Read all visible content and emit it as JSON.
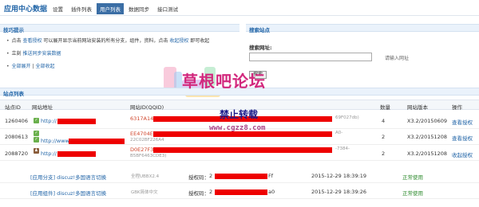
{
  "app": {
    "title": "应用中心数据"
  },
  "nav": {
    "tabs": [
      {
        "label": "设置"
      },
      {
        "label": "插件列表"
      },
      {
        "label": "用户列表"
      },
      {
        "label": "数据同步"
      },
      {
        "label": "接口测试"
      }
    ]
  },
  "tips": {
    "heading": "技巧提示",
    "line1_pre": "点击",
    "line1_link1": "查看授权",
    "line1_mid": "可以展开显示当前网站安装的所有分支，组件，资料，点击",
    "line1_link2": "收起授权",
    "line1_post": "即可收起",
    "line2_pre": "立刻",
    "line2_link": "推送同步安装数据",
    "line3_link1": "全部展开",
    "line3_sep": "|",
    "line3_link2": "全部收起"
  },
  "search": {
    "heading": "搜索站点",
    "label": "搜索网址:",
    "value": "",
    "placeholder": "",
    "hint": "请输入网址",
    "button": "搜索"
  },
  "sites": {
    "heading": "站点列表",
    "columns": [
      "站点ID",
      "网站地址",
      "网站ID(QQID)",
      "数量",
      "网站版本",
      "操作"
    ],
    "rows": [
      {
        "id": "1260406",
        "url": "http://",
        "qqid": "6317A14",
        "qqid_tail": "69F027db)",
        "sub": "",
        "count": "4",
        "version": "X3.2/20150609",
        "op": "查看授权"
      },
      {
        "id": "2080613",
        "url": "http://www.",
        "qqid": "EE4704E",
        "qqid_tail": "A0-",
        "sub": "22C02BF226A4",
        "count": "2",
        "version": "X3.2/20151208",
        "op": "查看授权"
      },
      {
        "id": "2088720",
        "url": "http://",
        "qqid": "D0E27F3",
        "qqid_tail": "-7384-",
        "sub": "B5BF6463CDE3)",
        "count": "2",
        "version": "X3.2/20151208",
        "op": "收起授权"
      }
    ]
  },
  "apps": [
    {
      "name": "[应用分支] discuz!多国语言切换",
      "tag": "全程UBBX2.4",
      "auth_label": "授权码：",
      "auth_value": "2",
      "auth_tail": "Ff",
      "time": "2015-12-29 18:39:19",
      "status": "正常使用"
    },
    {
      "name": "[应用组件] discuz!多国语言切换",
      "tag": "GBK简体中文",
      "auth_label": "授权码：",
      "auth_value": "2",
      "auth_tail": "a0",
      "time": "2015-12-29 18:39:26",
      "status": "正常使用"
    }
  ],
  "watermark": {
    "line1": "草根吧论坛",
    "line2": "禁止转载",
    "line3": "www.cgzz8.com"
  },
  "colors": {
    "accent": "#2366a8",
    "tab_active": "#3b6ea5",
    "redaction": "#ee0000",
    "qqid": "#d0462c",
    "status_ok": "#2e8b2e"
  },
  "icons": {
    "row1": [
      "check-icon"
    ],
    "row2": [
      "check-icon",
      "check-icon"
    ],
    "row3": [
      "user-icon"
    ]
  }
}
